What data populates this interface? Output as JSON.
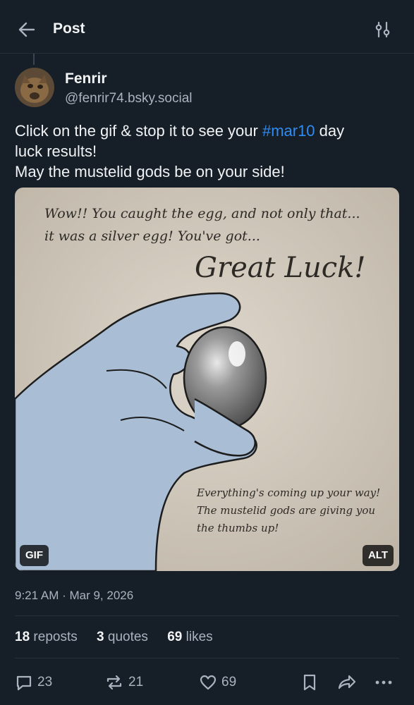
{
  "header": {
    "title": "Post"
  },
  "author": {
    "name": "Fenrir",
    "handle": "@fenrir74.bsky.social"
  },
  "post": {
    "line1_before": "Click on the gif & stop it to see your ",
    "hashtag": "#mar10",
    "line1_after": " day",
    "line2": "luck results!",
    "line3": "May the mustelid gods be on your side!"
  },
  "media": {
    "gif_badge": "GIF",
    "alt_badge": "ALT",
    "image_text": {
      "top_line1": "Wow!! You caught the egg, and not only that...",
      "top_line2": "it was a silver egg! You've got...",
      "headline": "Great Luck!",
      "bottom_line1": "Everything's coming up your way!",
      "bottom_line2": "The mustelid gods are giving you",
      "bottom_line3": "the thumbs up!"
    }
  },
  "timestamp": "9:21 AM · Mar 9, 2026",
  "stats": {
    "reposts_count": "18",
    "reposts_label": "reposts",
    "quotes_count": "3",
    "quotes_label": "quotes",
    "likes_count": "69",
    "likes_label": "likes"
  },
  "actions": {
    "reply_count": "23",
    "repost_count": "21",
    "like_count": "69"
  },
  "colors": {
    "background": "#161e27",
    "accent": "#2f8cf0",
    "muted": "#aab3bf"
  }
}
